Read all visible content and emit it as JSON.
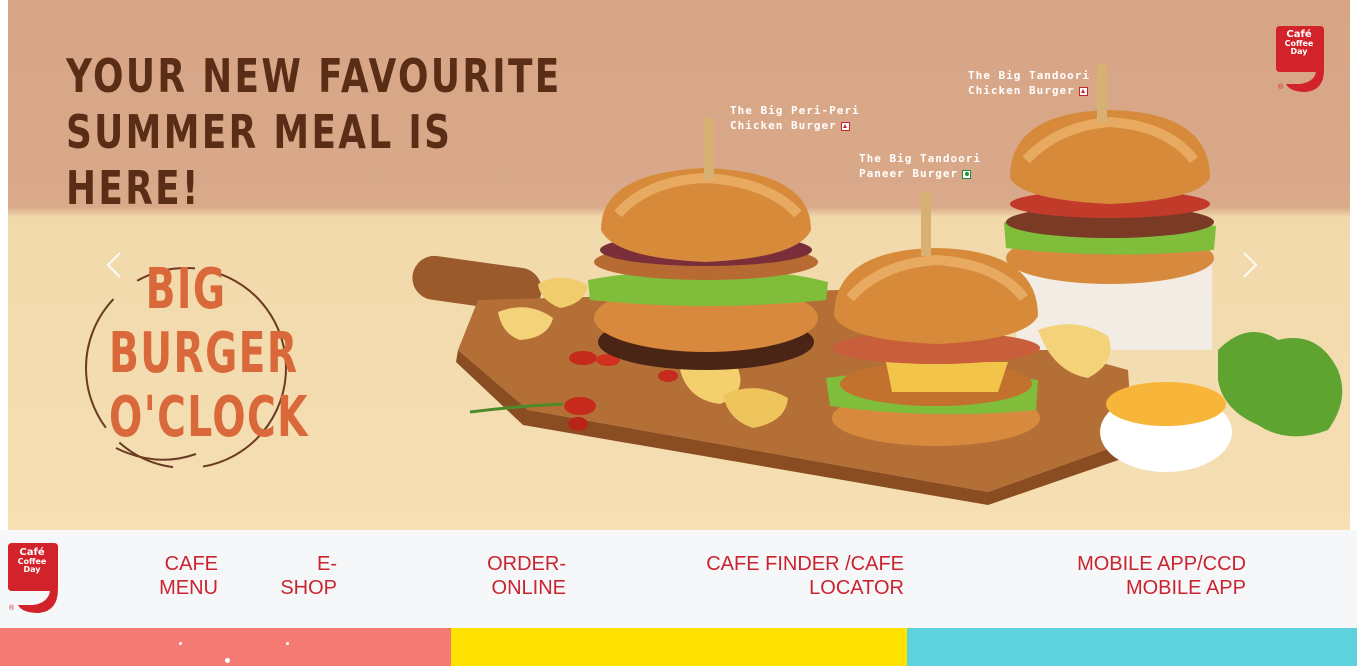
{
  "brand": {
    "logo_line1": "Café",
    "logo_line2": "Coffee",
    "logo_line3": "Day",
    "logo_mark": "®",
    "brand_color": "#d2232a"
  },
  "hero": {
    "headline_line1": "YOUR NEW FAVOURITE",
    "headline_line2": "SUMMER MEAL IS HERE!",
    "stamp_line1": "BIG",
    "stamp_line2": "BURGER",
    "stamp_line3": "O'CLOCK",
    "prev_icon": "chevron-left-icon",
    "next_icon": "chevron-right-icon",
    "burgers": [
      {
        "line1": "The Big Peri-Peri",
        "line2": "Chicken Burger",
        "type": "non-veg"
      },
      {
        "line1": "The Big Tandoori",
        "line2": "Paneer Burger",
        "type": "veg"
      },
      {
        "line1": "The Big Tandoori",
        "line2": "Chicken Burger",
        "type": "non-veg"
      }
    ]
  },
  "nav": {
    "items": [
      {
        "line1": "CAFE",
        "line2": "MENU"
      },
      {
        "line1": "E-",
        "line2": "SHOP"
      },
      {
        "line1": "ORDER-",
        "line2": "ONLINE"
      },
      {
        "line1": "CAFE FINDER /CAFE",
        "line2": "LOCATOR"
      },
      {
        "line1": "MOBILE APP/CCD",
        "line2": "MOBILE APP"
      }
    ]
  },
  "colors": {
    "nav_text": "#c9242f",
    "strip_pink": "#f47a73",
    "strip_yellow": "#ffe200",
    "strip_teal": "#5dd2dc"
  }
}
